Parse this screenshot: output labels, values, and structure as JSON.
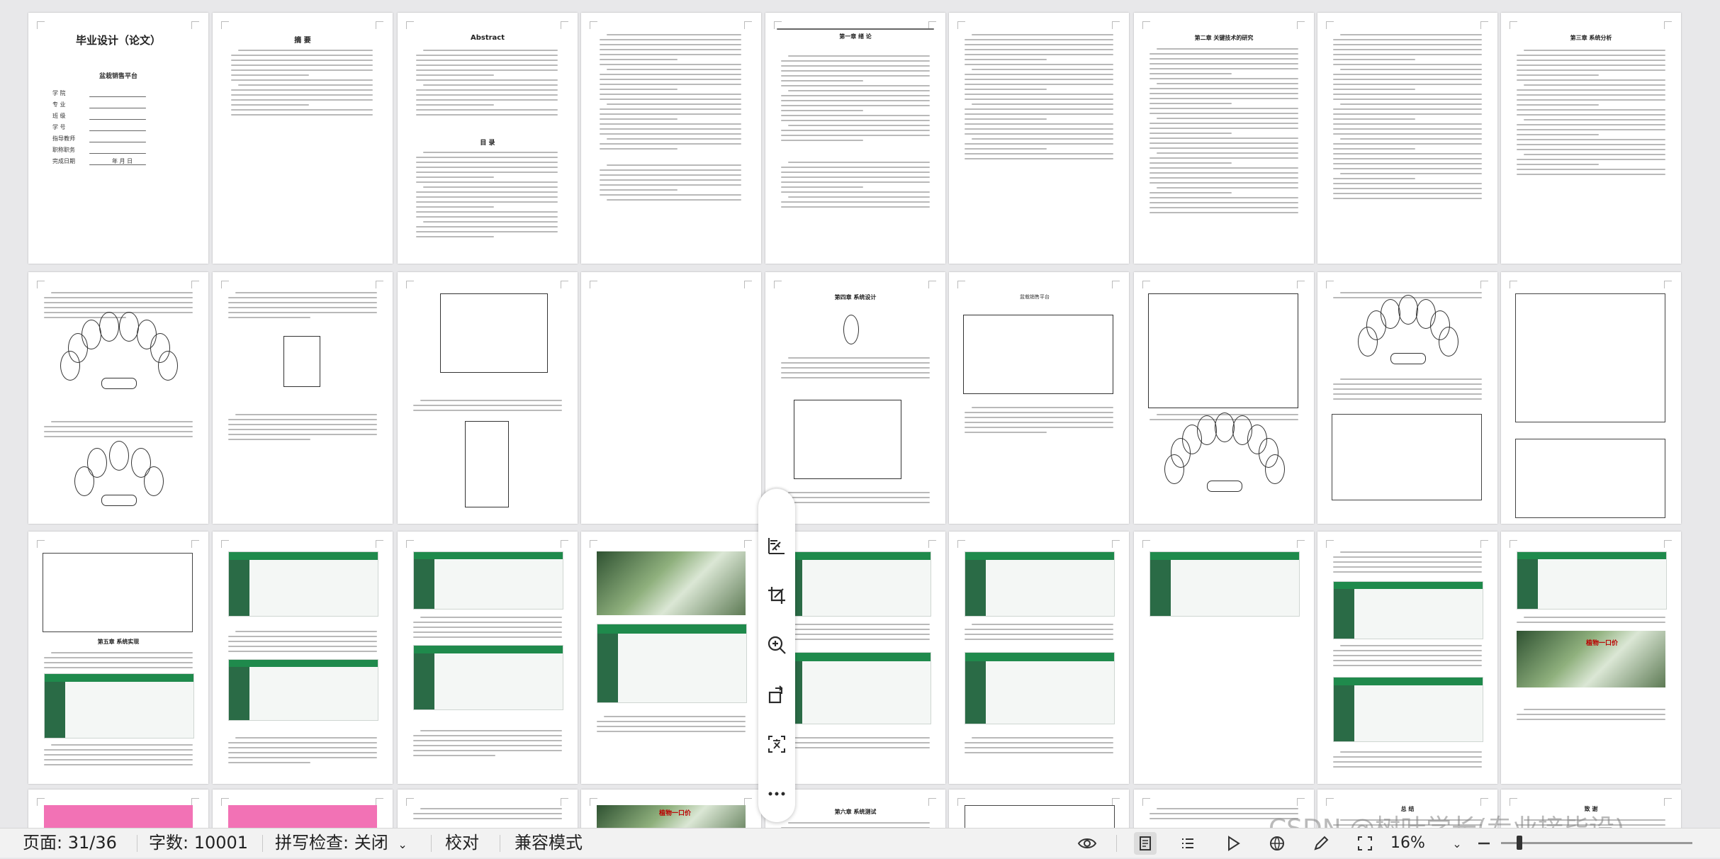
{
  "status_bar": {
    "page_indicator": "页面: 31/36",
    "word_count": "字数: 10001",
    "spell_check": "拼写检查: 关闭",
    "proofread": "校对",
    "compat_mode": "兼容模式",
    "zoom": "16%"
  },
  "pages": {
    "cover_title": "毕业设计（论文）",
    "cover_subtitle": "盆栽销售平台",
    "cover_fields": [
      "学    院",
      "专    业",
      "班    级",
      "学    号",
      "指导教师",
      "职称职务",
      "完成日期"
    ],
    "cover_date_suffix": "年  月  日",
    "abstract_cn_title": "摘  要",
    "abstract_en_title": "Abstract",
    "toc_title": "目  录",
    "ch1_title": "第一章  绪  论",
    "ch2_title": "第二章  关键技术的研究",
    "ch3_title": "第三章  系统分析",
    "ch4_title": "第四章  系统设计",
    "ch5_title": "第五章  系统实现",
    "ch6_title": "第六章  系统测试",
    "conclusion_title": "总  结",
    "ack_title": "致  谢",
    "platform_name": "盆栽销售平台",
    "banner_text": "植物一口价"
  },
  "toolbar": {
    "icons": [
      "zoom-out-icon",
      "ruler-icon",
      "crop-icon",
      "zoom-in-icon",
      "rotate-icon",
      "translate-icon",
      "more-icon"
    ]
  },
  "watermark": "CSDN @树叶学长(专业接毕设)"
}
